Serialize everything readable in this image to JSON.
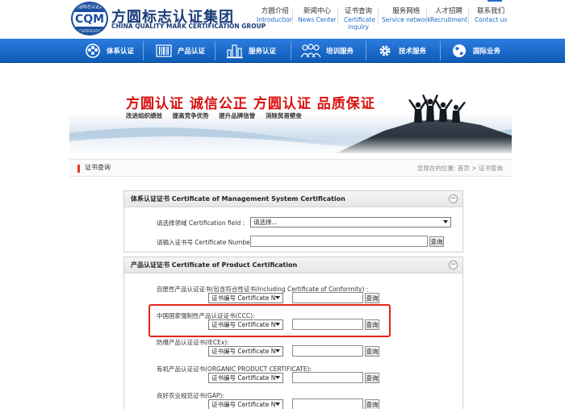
{
  "header": {
    "logo": {
      "top_text": "方圆标志认证集团",
      "letters": "CQM",
      "bottom_text": "CERTIFICATION"
    },
    "brand_cn": "方圆标志认证集团",
    "brand_en": "CHINA QUALITY MARK CERTIFICATION GROUP",
    "top_nav": [
      {
        "cn": "方圆介绍",
        "en": "Introduction"
      },
      {
        "cn": "新闻中心",
        "en": "News Center"
      },
      {
        "cn": "证书查询",
        "en": "Certificate inquiry"
      },
      {
        "cn": "服务网络",
        "en": "Service network"
      },
      {
        "cn": "人才招聘",
        "en": "Recruitment"
      },
      {
        "cn": "联系我们",
        "en": "Contact us"
      }
    ]
  },
  "main_nav": [
    {
      "label": "体系认证",
      "icon": "system-cert-icon"
    },
    {
      "label": "产品认证",
      "icon": "barcode-icon"
    },
    {
      "label": "服务认证",
      "icon": "buildings-icon"
    },
    {
      "label": "培训服务",
      "icon": "people-icon"
    },
    {
      "label": "技术服务",
      "icon": "gear-icon"
    },
    {
      "label": "国际业务",
      "icon": "globe-icon"
    }
  ],
  "banner": {
    "slogan": "方圆认证 诚信公正 方圆认证 品质保证",
    "subtitle": "改进组织绩效 提高竞争优势 提升品牌信誉 消除贸易壁垒"
  },
  "breadcrumb": {
    "title": "证书查询",
    "location_label": "您现在的位置:",
    "home": "首页",
    "separator": ">",
    "current": "证书查询"
  },
  "management_panel": {
    "title": "体系认证证书 Certificate of Management System Certification",
    "field_label": "请选择领域 Certification field :",
    "field_value": "请选择...",
    "number_label": "请输入证书号 Certificate Number:",
    "query_button": "查询"
  },
  "product_panel": {
    "title": "产品认证证书 Certificate of Product Certification",
    "rows": [
      {
        "label": "自愿性产品认证证书(包含符合性证书/including Certificate of Conformity) :",
        "select": "证书编号 Certificate N",
        "query_button": "查询"
      },
      {
        "label": "中国国家强制性产品认证证书(CCC):",
        "select": "证书编号 Certificate N",
        "query_button": "查询"
      },
      {
        "label": "防爆产品认证证书(IECEx):",
        "select": "证书编号 Certificate N",
        "query_button": "查询"
      },
      {
        "label": "有机产品认证证书(ORGANIC PRODUCT CERTIFICATE):",
        "select": "证书编号 Certificate N",
        "query_button": "查询"
      },
      {
        "label": "良好农业规范证书(GAP):",
        "select": "证书编号 Certificate N",
        "query_button": "查询"
      }
    ]
  },
  "colors": {
    "nav_blue": "#0d5cb6",
    "slogan_red": "#d90f0f",
    "highlight_red": "#e8241c",
    "brand_navy": "#1a3c7a"
  }
}
